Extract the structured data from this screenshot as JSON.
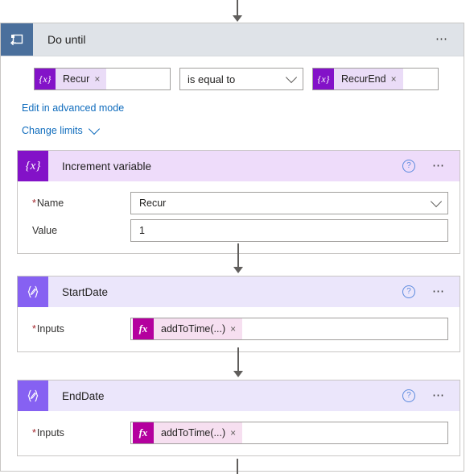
{
  "colors": {
    "do_until_icon_bg": "#4a6f9c",
    "do_until_header_bg": "#dfe3e8",
    "variable_icon_bg": "#8312c8",
    "variable_header_bg": "#eedcfa",
    "compose_icon_bg": "#8661f2",
    "compose_header_bg": "#ebe6fb",
    "token_chip_bg": "#eadcf7",
    "fx_chip_bg": "#f6dff0",
    "fx_icon_bg": "#b4009e",
    "link_blue": "#0f6cbd",
    "required_red": "#a4262c",
    "connector_gray": "#605e5c"
  },
  "do_until": {
    "title": "Do until",
    "icon": "loop-icon",
    "menu_icon": "ellipsis-icon",
    "condition": {
      "left_token": {
        "icon": "variable-token-icon",
        "icon_glyph": "{x}",
        "label": "Recur",
        "remove_icon": "close-icon",
        "remove_glyph": "×"
      },
      "operator": {
        "value": "is equal to",
        "chevron_icon": "chevron-down-icon"
      },
      "right_token": {
        "icon": "variable-token-icon",
        "icon_glyph": "{x}",
        "label": "RecurEnd",
        "remove_icon": "close-icon",
        "remove_glyph": "×"
      }
    },
    "advanced_mode_link": "Edit in advanced mode",
    "change_limits_link": "Change limits",
    "change_limits_chevron": "chevron-down-icon"
  },
  "actions": [
    {
      "title": "Increment variable",
      "icon": "variable-icon",
      "icon_glyph": "{x}",
      "help_icon": "help-icon",
      "help_glyph": "?",
      "menu_icon": "ellipsis-icon",
      "fields": [
        {
          "label": "Name",
          "required": true,
          "value": "Recur",
          "type": "dropdown",
          "chevron_icon": "chevron-down-icon"
        },
        {
          "label": "Value",
          "required": false,
          "value": "1",
          "type": "text"
        }
      ]
    },
    {
      "title": "StartDate",
      "icon": "compose-icon",
      "icon_glyph": "{⁄}",
      "help_icon": "help-icon",
      "help_glyph": "?",
      "menu_icon": "ellipsis-icon",
      "fields": [
        {
          "label": "Inputs",
          "required": true,
          "type": "token",
          "token": {
            "icon": "function-token-icon",
            "icon_glyph": "fx",
            "label": "addToTime(...)",
            "remove_icon": "close-icon",
            "remove_glyph": "×"
          }
        }
      ]
    },
    {
      "title": "EndDate",
      "icon": "compose-icon",
      "icon_glyph": "{⁄}",
      "help_icon": "help-icon",
      "help_glyph": "?",
      "menu_icon": "ellipsis-icon",
      "fields": [
        {
          "label": "Inputs",
          "required": true,
          "type": "token",
          "token": {
            "icon": "function-token-icon",
            "icon_glyph": "fx",
            "label": "addToTime(...)",
            "remove_icon": "close-icon",
            "remove_glyph": "×"
          }
        }
      ]
    }
  ],
  "connectors": [
    {
      "name": "connector-top"
    },
    {
      "name": "connector-increment-to-startdate"
    },
    {
      "name": "connector-startdate-to-enddate"
    },
    {
      "name": "connector-bottom"
    }
  ]
}
